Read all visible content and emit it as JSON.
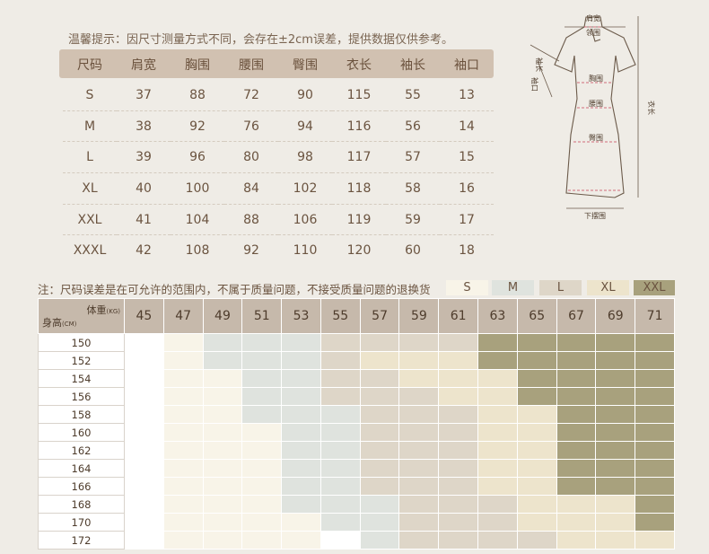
{
  "notice": "温馨提示：因尺寸测量方式不同，会存在±2cm误差，提供数据仅供参考。",
  "size_table": {
    "headers": [
      "尺码",
      "肩宽",
      "胸围",
      "腰围",
      "臀围",
      "衣长",
      "袖长",
      "袖口"
    ],
    "rows": [
      [
        "S",
        "37",
        "88",
        "72",
        "90",
        "115",
        "55",
        "13"
      ],
      [
        "M",
        "38",
        "92",
        "76",
        "94",
        "116",
        "56",
        "14"
      ],
      [
        "L",
        "39",
        "96",
        "80",
        "98",
        "117",
        "57",
        "15"
      ],
      [
        "XL",
        "40",
        "100",
        "84",
        "102",
        "118",
        "58",
        "16"
      ],
      [
        "XXL",
        "41",
        "104",
        "88",
        "106",
        "119",
        "59",
        "17"
      ],
      [
        "XXXL",
        "42",
        "108",
        "92",
        "110",
        "120",
        "60",
        "18"
      ]
    ]
  },
  "figure_labels": {
    "shoulder": "肩宽",
    "collar": "领围",
    "sleeve_length": "袖长",
    "cuff": "袖口",
    "bust": "胸围",
    "waist": "腰围",
    "hip": "臀围",
    "length": "衣长",
    "hem": "下摆围"
  },
  "note2": "注：尺码误差是在可允许的范围内，不属于质量问题，不接受质量问题的退换货",
  "legend": [
    {
      "label": "S",
      "color": "#f8f4e8"
    },
    {
      "label": "M",
      "color": "#dfe3de"
    },
    {
      "label": "L",
      "color": "#ded6c8"
    },
    {
      "label": "XL",
      "color": "#ede4cc"
    },
    {
      "label": "XXL",
      "color": "#a8a17d"
    }
  ],
  "grid": {
    "weight_label": "体重",
    "weight_unit": "(KG)",
    "height_label": "身高",
    "height_unit": "(CM)",
    "weights": [
      "45",
      "47",
      "49",
      "51",
      "53",
      "55",
      "57",
      "59",
      "61",
      "63",
      "65",
      "67",
      "69",
      "71"
    ],
    "heights": [
      "150",
      "152",
      "154",
      "156",
      "158",
      "160",
      "162",
      "164",
      "166",
      "168",
      "170",
      "172"
    ],
    "cells": [
      [
        0,
        1,
        2,
        2,
        2,
        3,
        3,
        3,
        3,
        5,
        5,
        5,
        5,
        5
      ],
      [
        0,
        1,
        2,
        2,
        2,
        3,
        4,
        4,
        4,
        5,
        5,
        5,
        5,
        5
      ],
      [
        0,
        1,
        1,
        2,
        2,
        3,
        3,
        4,
        4,
        4,
        5,
        5,
        5,
        5
      ],
      [
        0,
        1,
        1,
        2,
        2,
        3,
        3,
        3,
        4,
        4,
        5,
        5,
        5,
        5
      ],
      [
        0,
        1,
        1,
        2,
        2,
        2,
        3,
        3,
        3,
        4,
        4,
        5,
        5,
        5
      ],
      [
        0,
        1,
        1,
        1,
        2,
        2,
        3,
        3,
        3,
        4,
        4,
        5,
        5,
        5
      ],
      [
        0,
        1,
        1,
        1,
        2,
        2,
        3,
        3,
        3,
        4,
        4,
        5,
        5,
        5
      ],
      [
        0,
        1,
        1,
        1,
        2,
        2,
        3,
        3,
        3,
        4,
        4,
        5,
        5,
        5
      ],
      [
        0,
        1,
        1,
        1,
        2,
        2,
        3,
        3,
        3,
        4,
        4,
        5,
        5,
        5
      ],
      [
        0,
        1,
        1,
        1,
        2,
        2,
        2,
        3,
        3,
        3,
        4,
        4,
        4,
        5
      ],
      [
        0,
        1,
        1,
        1,
        1,
        2,
        2,
        3,
        3,
        3,
        4,
        4,
        4,
        5
      ],
      [
        0,
        1,
        1,
        1,
        1,
        0,
        2,
        3,
        3,
        3,
        3,
        4,
        4,
        4
      ]
    ]
  }
}
